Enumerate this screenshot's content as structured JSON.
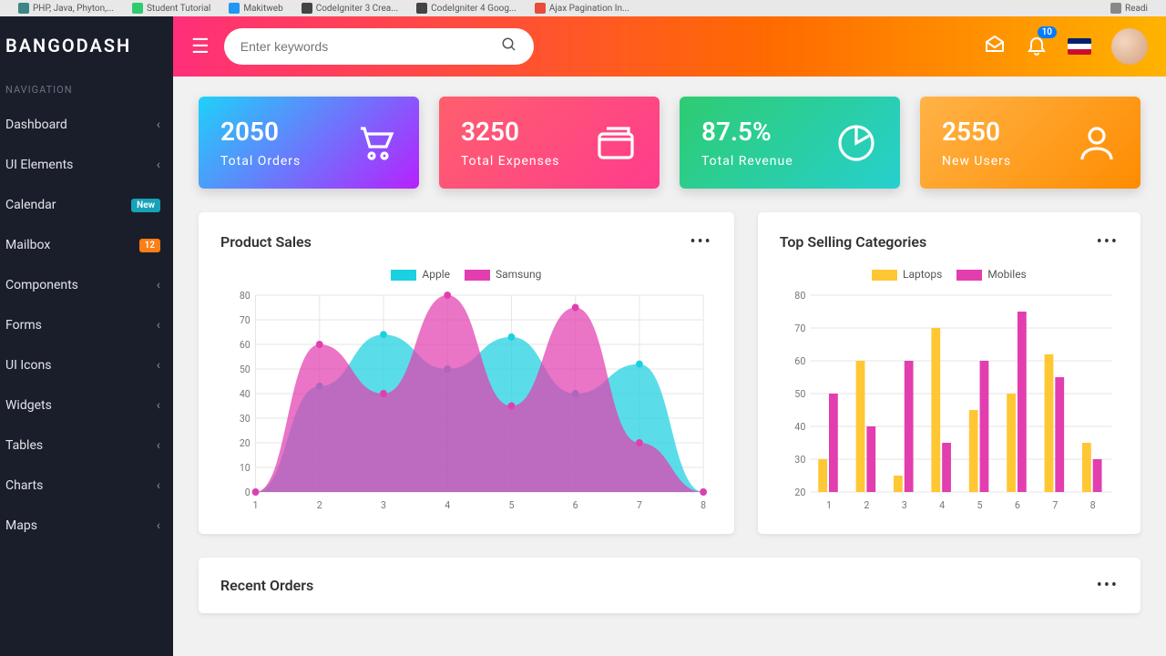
{
  "browser": {
    "tabs": [
      "PHP, Java, Phyton,...",
      "Student Tutorial",
      "Makitweb",
      "CodeIgniter 3 Crea...",
      "CodeIgniter 4 Goog...",
      "Ajax Pagination In..."
    ],
    "reading": "Readi"
  },
  "brand": "BangoDash",
  "nav_header": "NAVIGATION",
  "sidebar": {
    "items": [
      {
        "label": "Dashboard"
      },
      {
        "label": "UI Elements"
      },
      {
        "label": "Calendar",
        "badge": "New",
        "badge_type": "new"
      },
      {
        "label": "Mailbox",
        "badge": "12",
        "badge_type": "count"
      },
      {
        "label": "Components"
      },
      {
        "label": "Forms"
      },
      {
        "label": "UI Icons"
      },
      {
        "label": "Widgets"
      },
      {
        "label": "Tables"
      },
      {
        "label": "Charts"
      },
      {
        "label": "Maps"
      }
    ]
  },
  "search": {
    "placeholder": "Enter keywords"
  },
  "notifications": {
    "count": "10"
  },
  "cards": [
    {
      "value": "2050",
      "label": "Total Orders",
      "icon": "cart-icon"
    },
    {
      "value": "3250",
      "label": "Total Expenses",
      "icon": "wallet-icon"
    },
    {
      "value": "87.5%",
      "label": "Total Revenue",
      "icon": "pie-icon"
    },
    {
      "value": "2550",
      "label": "New Users",
      "icon": "user-icon"
    }
  ],
  "panel1": {
    "title": "Product Sales"
  },
  "panel2": {
    "title": "Top Selling Categories"
  },
  "recent": {
    "title": "Recent Orders"
  },
  "chart_data": [
    {
      "type": "area",
      "title": "Product Sales",
      "categories": [
        1,
        2,
        3,
        4,
        5,
        6,
        7,
        8
      ],
      "ylim": [
        0,
        80
      ],
      "series": [
        {
          "name": "Apple",
          "color": "#1bd0e0",
          "values": [
            0,
            43,
            64,
            50,
            63,
            40,
            52,
            0
          ]
        },
        {
          "name": "Samsung",
          "color": "#e23eb0",
          "values": [
            0,
            60,
            40,
            80,
            35,
            75,
            20,
            0
          ]
        }
      ]
    },
    {
      "type": "bar",
      "title": "Top Selling Categories",
      "categories": [
        1,
        2,
        3,
        4,
        5,
        6,
        7,
        8
      ],
      "ylim": [
        20,
        80
      ],
      "series": [
        {
          "name": "Laptops",
          "color": "#ffc733",
          "values": [
            30,
            60,
            25,
            70,
            45,
            50,
            62,
            35
          ]
        },
        {
          "name": "Mobiles",
          "color": "#e23eb0",
          "values": [
            50,
            40,
            60,
            35,
            60,
            75,
            55,
            30
          ]
        }
      ]
    }
  ]
}
